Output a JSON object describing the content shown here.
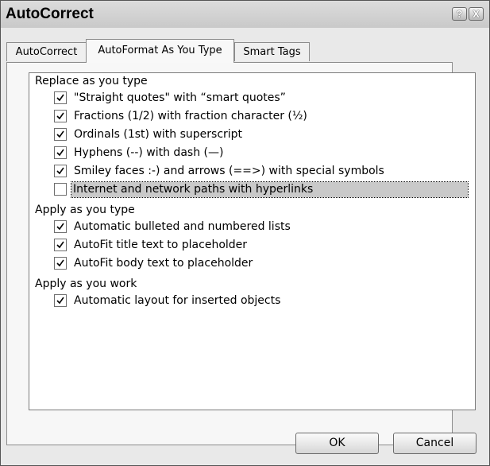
{
  "window": {
    "title": "AutoCorrect"
  },
  "titlebar_buttons": {
    "help": "?",
    "close": "X"
  },
  "tabs": [
    {
      "label": "AutoCorrect",
      "active": false
    },
    {
      "label": "AutoFormat As You Type",
      "active": true
    },
    {
      "label": "Smart Tags",
      "active": false
    }
  ],
  "groups": [
    {
      "heading": "Replace as you type",
      "items": [
        {
          "label": "\"Straight quotes\" with “smart quotes”",
          "checked": true
        },
        {
          "label": "Fractions (1/2) with fraction character (½)",
          "checked": true
        },
        {
          "label": "Ordinals (1st) with superscript",
          "checked": true
        },
        {
          "label": "Hyphens (--) with dash (—)",
          "checked": true
        },
        {
          "label": "Smiley faces :-) and arrows (==>) with special symbols",
          "checked": true
        },
        {
          "label": "Internet and network paths with hyperlinks",
          "checked": false,
          "focused": true
        }
      ]
    },
    {
      "heading": "Apply as you type",
      "items": [
        {
          "label": "Automatic bulleted and numbered lists",
          "checked": true
        },
        {
          "label": "AutoFit title text to placeholder",
          "checked": true
        },
        {
          "label": "AutoFit body text to placeholder",
          "checked": true
        }
      ]
    },
    {
      "heading": "Apply as you work",
      "items": [
        {
          "label": "Automatic layout for inserted objects",
          "checked": true
        }
      ]
    }
  ],
  "buttons": {
    "ok": "OK",
    "cancel": "Cancel"
  }
}
